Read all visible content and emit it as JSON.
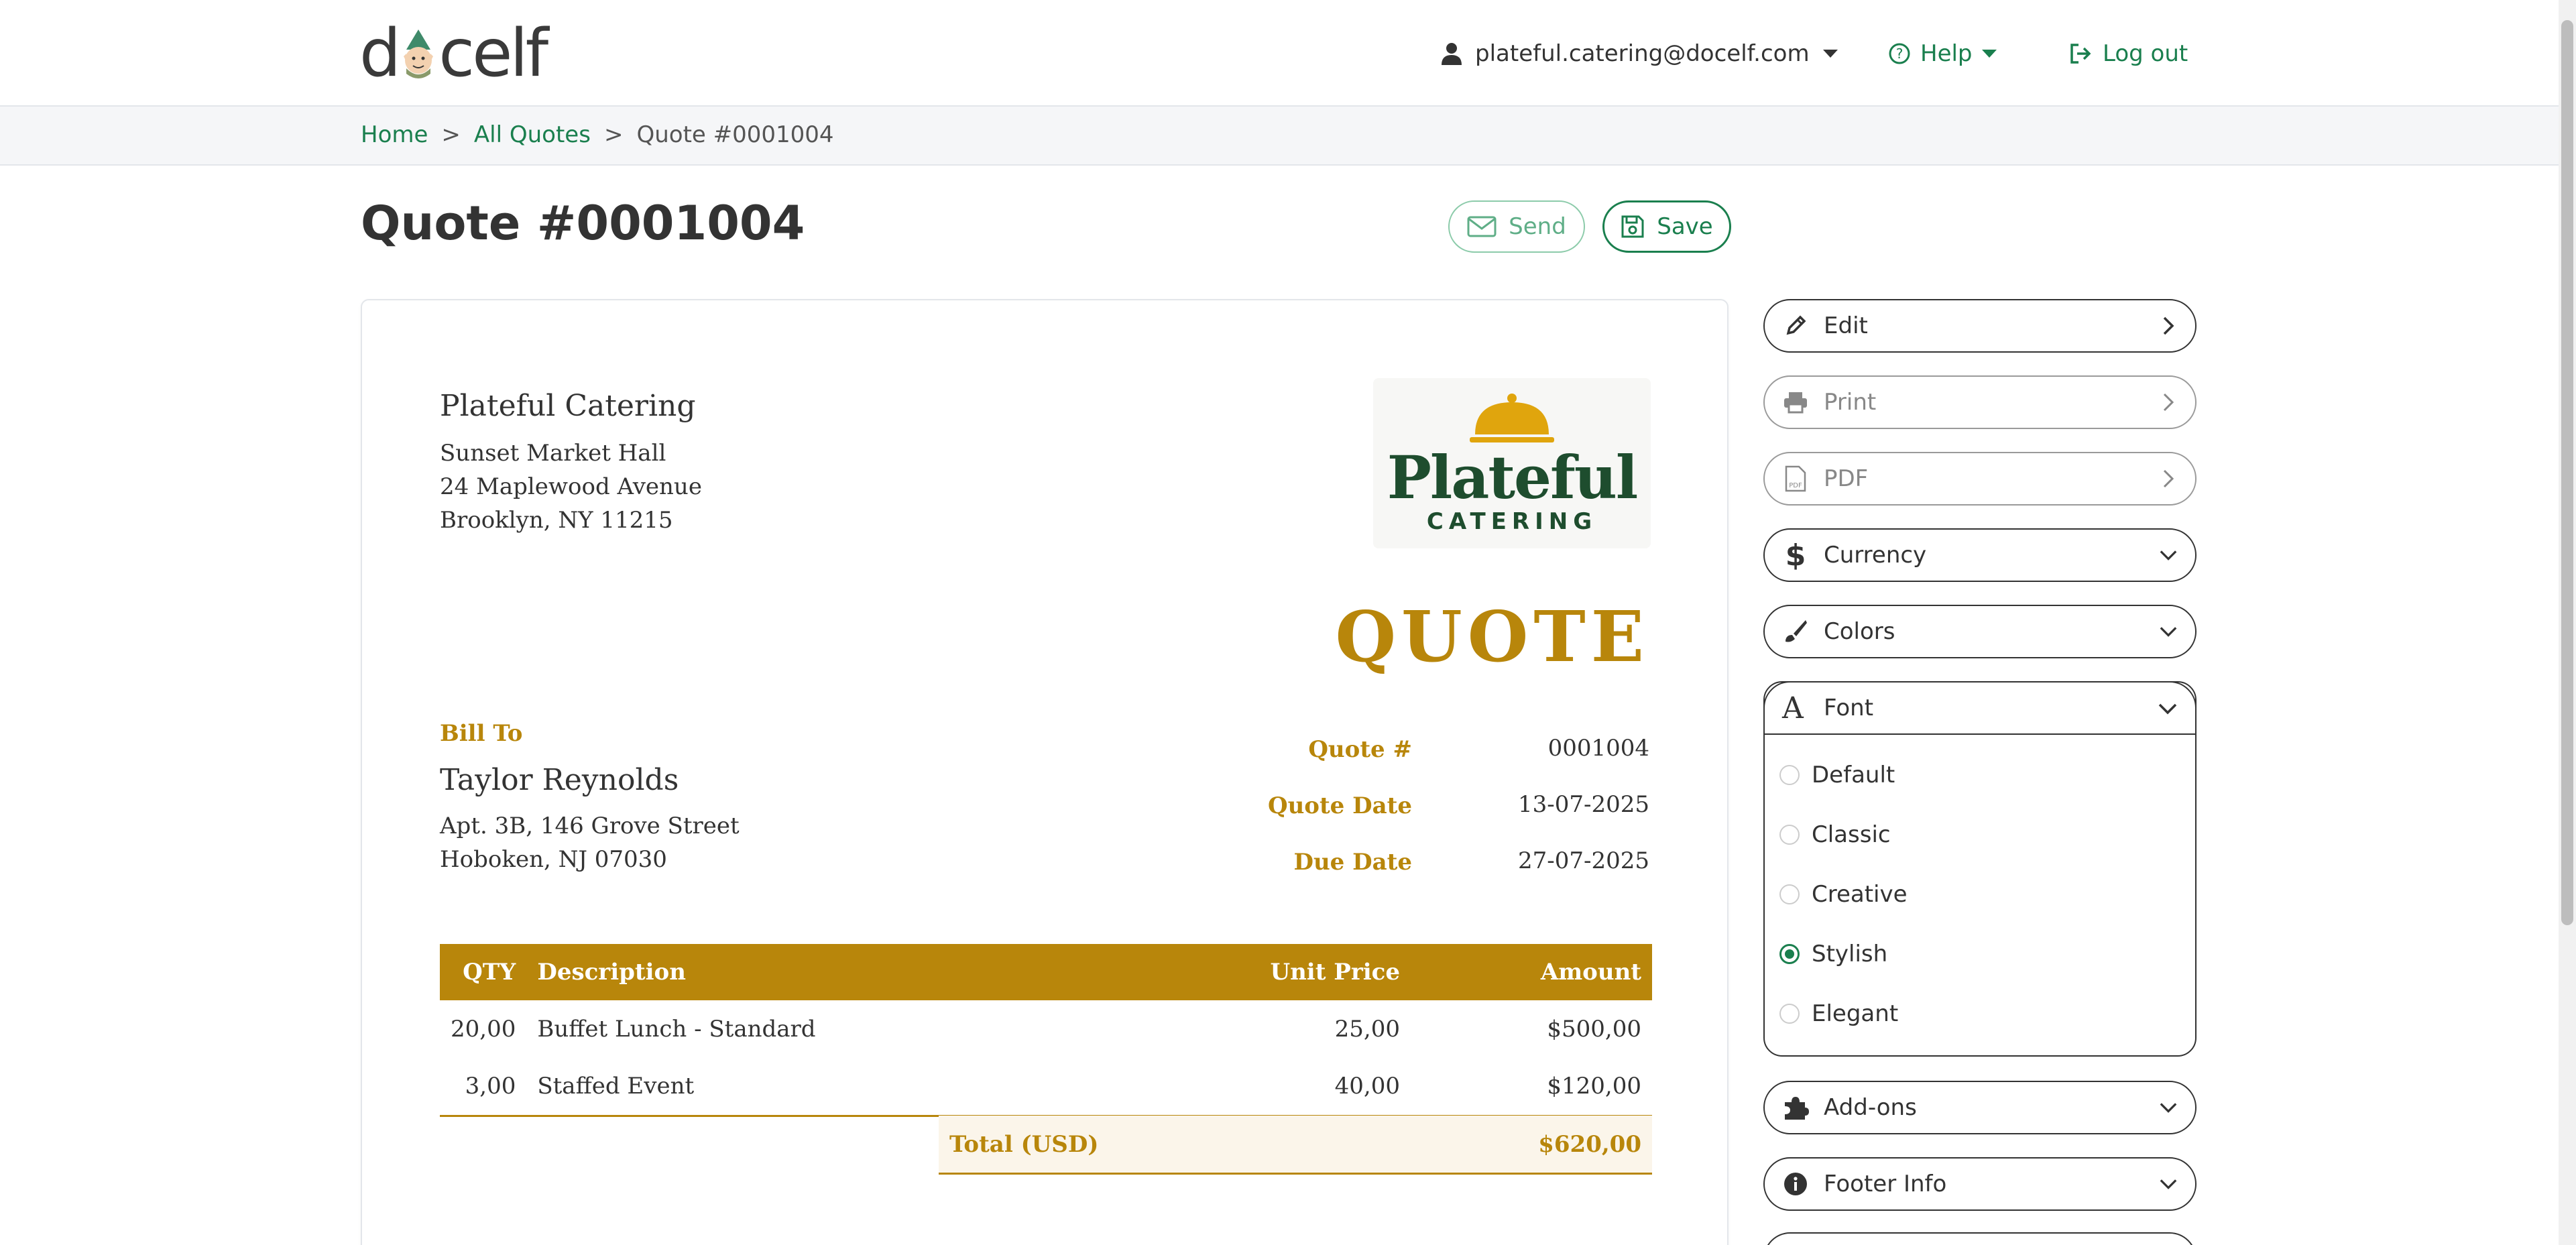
{
  "header": {
    "logo_text_left": "d",
    "logo_text_right": "celf",
    "user_email": "plateful.catering@docelf.com",
    "help_label": "Help",
    "logout_label": "Log out"
  },
  "breadcrumb": {
    "home": "Home",
    "sep": ">",
    "all_quotes": "All Quotes",
    "current": "Quote #0001004"
  },
  "page": {
    "title": "Quote #0001004",
    "send_label": "Send",
    "save_label": "Save"
  },
  "document": {
    "company_name": "Plateful Catering",
    "company_address": [
      "Sunset Market Hall",
      "24 Maplewood Avenue",
      "Brooklyn, NY 11215"
    ],
    "logo_main": "Plateful",
    "logo_sub": "CATERING",
    "doc_type": "QUOTE",
    "bill_to_label": "Bill To",
    "client_name": "Taylor Reynolds",
    "client_address": [
      "Apt. 3B, 146 Grove Street",
      "Hoboken, NJ 07030"
    ],
    "meta": [
      {
        "label": "Quote #",
        "value": "0001004"
      },
      {
        "label": "Quote Date",
        "value": "13-07-2025"
      },
      {
        "label": "Due Date",
        "value": "27-07-2025"
      }
    ],
    "table_headers": {
      "qty": "QTY",
      "description": "Description",
      "unit_price": "Unit Price",
      "amount": "Amount"
    },
    "items": [
      {
        "qty": "20,00",
        "description": "Buffet Lunch - Standard",
        "unit_price": "25,00",
        "amount": "$500,00"
      },
      {
        "qty": "3,00",
        "description": "Staffed Event",
        "unit_price": "40,00",
        "amount": "$120,00"
      }
    ],
    "total_label": "Total (USD)",
    "total_value": "$620,00",
    "accent_color": "#b8860b"
  },
  "sidebar": {
    "edit": "Edit",
    "print": "Print",
    "pdf": "PDF",
    "currency": "Currency",
    "colors": "Colors",
    "font": "Font",
    "font_options": [
      "Default",
      "Classic",
      "Creative",
      "Stylish",
      "Elegant"
    ],
    "font_selected": "Stylish",
    "addons": "Add-ons",
    "footer_info": "Footer Info"
  },
  "theme": {
    "brand_green": "#1a7f4e",
    "text_dark": "#333333"
  }
}
